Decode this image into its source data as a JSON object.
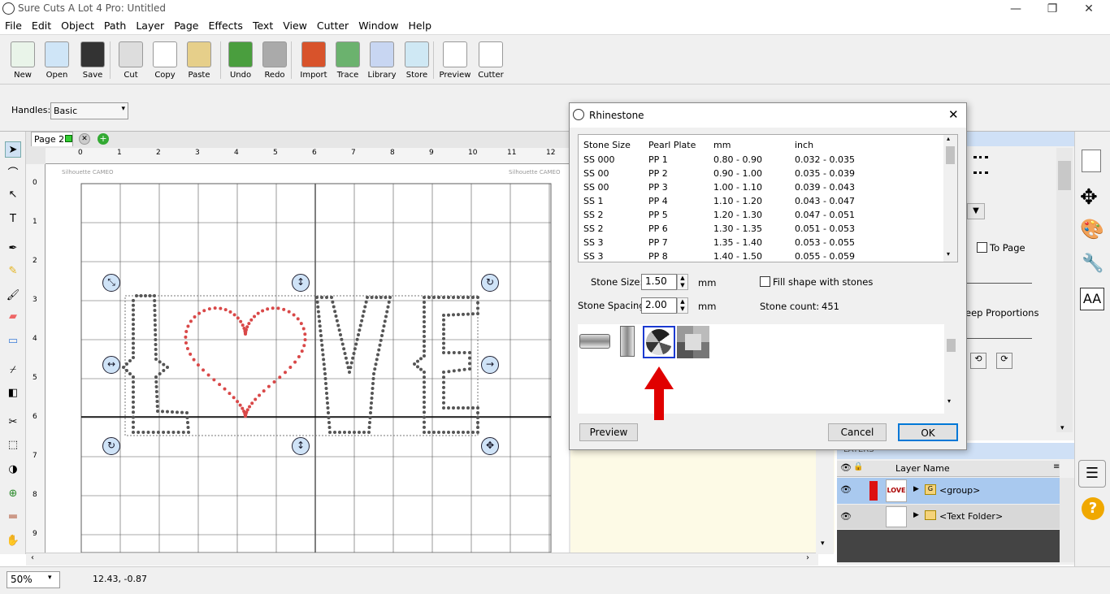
{
  "window": {
    "title": "Sure Cuts A Lot 4 Pro: Untitled",
    "controls": [
      "—",
      "❐",
      "✕"
    ]
  },
  "menu": [
    "File",
    "Edit",
    "Object",
    "Path",
    "Layer",
    "Page",
    "Effects",
    "Text",
    "View",
    "Cutter",
    "Window",
    "Help"
  ],
  "toolbar": {
    "buttons": [
      {
        "label": "New",
        "color": "#e9f4e9"
      },
      {
        "label": "Open",
        "color": "#cfe5f7"
      },
      {
        "label": "Save",
        "color": "#333"
      },
      {
        "label": "Cut",
        "color": "#ddd"
      },
      {
        "label": "Copy",
        "color": "#fff"
      },
      {
        "label": "Paste",
        "color": "#e6cf8a"
      },
      {
        "label": "Undo",
        "color": "#4a9e3e"
      },
      {
        "label": "Redo",
        "color": "#aaa"
      },
      {
        "label": "Import",
        "color": "#d8532b"
      },
      {
        "label": "Trace",
        "color": "#6bb26e"
      },
      {
        "label": "Library",
        "color": "#c8d6f2"
      },
      {
        "label": "Store",
        "color": "#cfe8f4"
      },
      {
        "label": "Preview",
        "color": "#fff"
      },
      {
        "label": "Cutter",
        "color": "#fff"
      }
    ]
  },
  "handles": {
    "label": "Handles:",
    "value": "Basic"
  },
  "page_tab": {
    "label": "Page 2"
  },
  "ruler": {
    "h_ticks": [
      "0",
      "1",
      "2",
      "3",
      "4",
      "5",
      "6",
      "7",
      "8",
      "9",
      "10",
      "11",
      "12"
    ],
    "v_ticks": [
      "0",
      "1",
      "2",
      "3",
      "4",
      "5",
      "6",
      "7",
      "8",
      "9"
    ],
    "mat_text": "Silhouette CAMEO"
  },
  "design": {
    "letters": [
      "L",
      "V",
      "E"
    ],
    "heart_color": "#d94848",
    "stone_color": "#555555"
  },
  "status": {
    "zoom": "50%",
    "coords": "12.43, -0.87"
  },
  "dialog": {
    "title": "Rhinestone",
    "columns": [
      "Stone Size",
      "Pearl Plate",
      "mm",
      "inch"
    ],
    "rows": [
      [
        "SS 000",
        "PP 1",
        "0.80 - 0.90",
        "0.032 - 0.035"
      ],
      [
        "SS 00",
        "PP 2",
        "0.90 - 1.00",
        "0.035 - 0.039"
      ],
      [
        "SS 00",
        "PP 3",
        "1.00 - 1.10",
        "0.039 - 0.043"
      ],
      [
        "SS 1",
        "PP 4",
        "1.10 - 1.20",
        "0.043 - 0.047"
      ],
      [
        "SS 2",
        "PP 5",
        "1.20 - 1.30",
        "0.047 - 0.051"
      ],
      [
        "SS 2",
        "PP 6",
        "1.30 - 1.35",
        "0.051 - 0.053"
      ],
      [
        "SS 3",
        "PP 7",
        "1.35 - 1.40",
        "0.053 - 0.055"
      ],
      [
        "SS 3",
        "PP 8",
        "1.40 - 1.50",
        "0.055 - 0.059"
      ]
    ],
    "stone_size_label": "Stone Size:",
    "stone_size": "1.50",
    "stone_spacing_label": "Stone Spacing:",
    "stone_spacing": "2.00",
    "unit": "mm",
    "fill_label": "Fill shape with stones",
    "count_label": "Stone count:",
    "count": "451",
    "preview_btn": "Preview",
    "cancel_btn": "Cancel",
    "ok_btn": "OK"
  },
  "right_panel": {
    "to_page": "To Page",
    "keep_proportions": "eep Proportions"
  },
  "layers": {
    "header": "LAYERS",
    "col": "Layer Name",
    "items": [
      {
        "name": "<group>",
        "thumb": "LOVE",
        "selected": true
      },
      {
        "name": "<Text Folder>",
        "thumb": "",
        "selected": false
      }
    ]
  }
}
